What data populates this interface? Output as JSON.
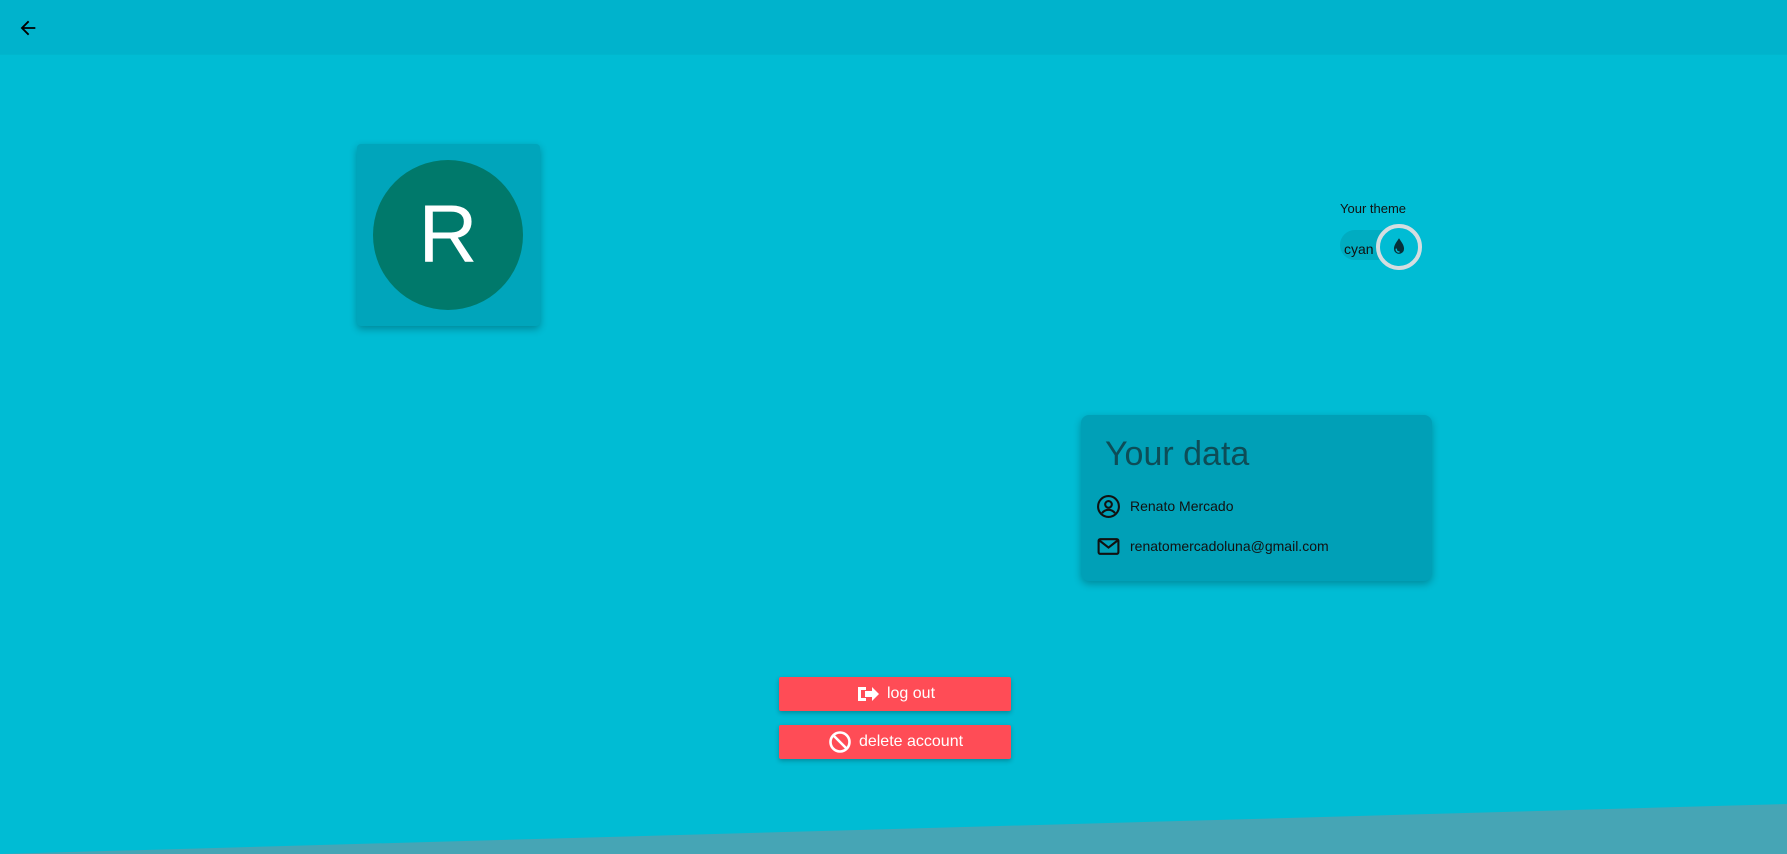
{
  "header": {
    "back_icon": "arrow-left-icon"
  },
  "profile": {
    "avatar_letter": "R",
    "avatar_color": "#00796b"
  },
  "theme": {
    "label": "Your theme",
    "value": "cyan",
    "icon": "droplet-icon",
    "accent": "#00bcd4"
  },
  "user_data": {
    "title": "Your data",
    "name": "Renato Mercado",
    "email": "renatomercadoluna@gmail.com",
    "name_icon": "user-circle-icon",
    "email_icon": "envelope-icon"
  },
  "actions": {
    "logout_label": "log out",
    "delete_label": "delete account",
    "logout_icon": "sign-out-icon",
    "delete_icon": "ban-icon",
    "button_color": "#ff4c56"
  }
}
